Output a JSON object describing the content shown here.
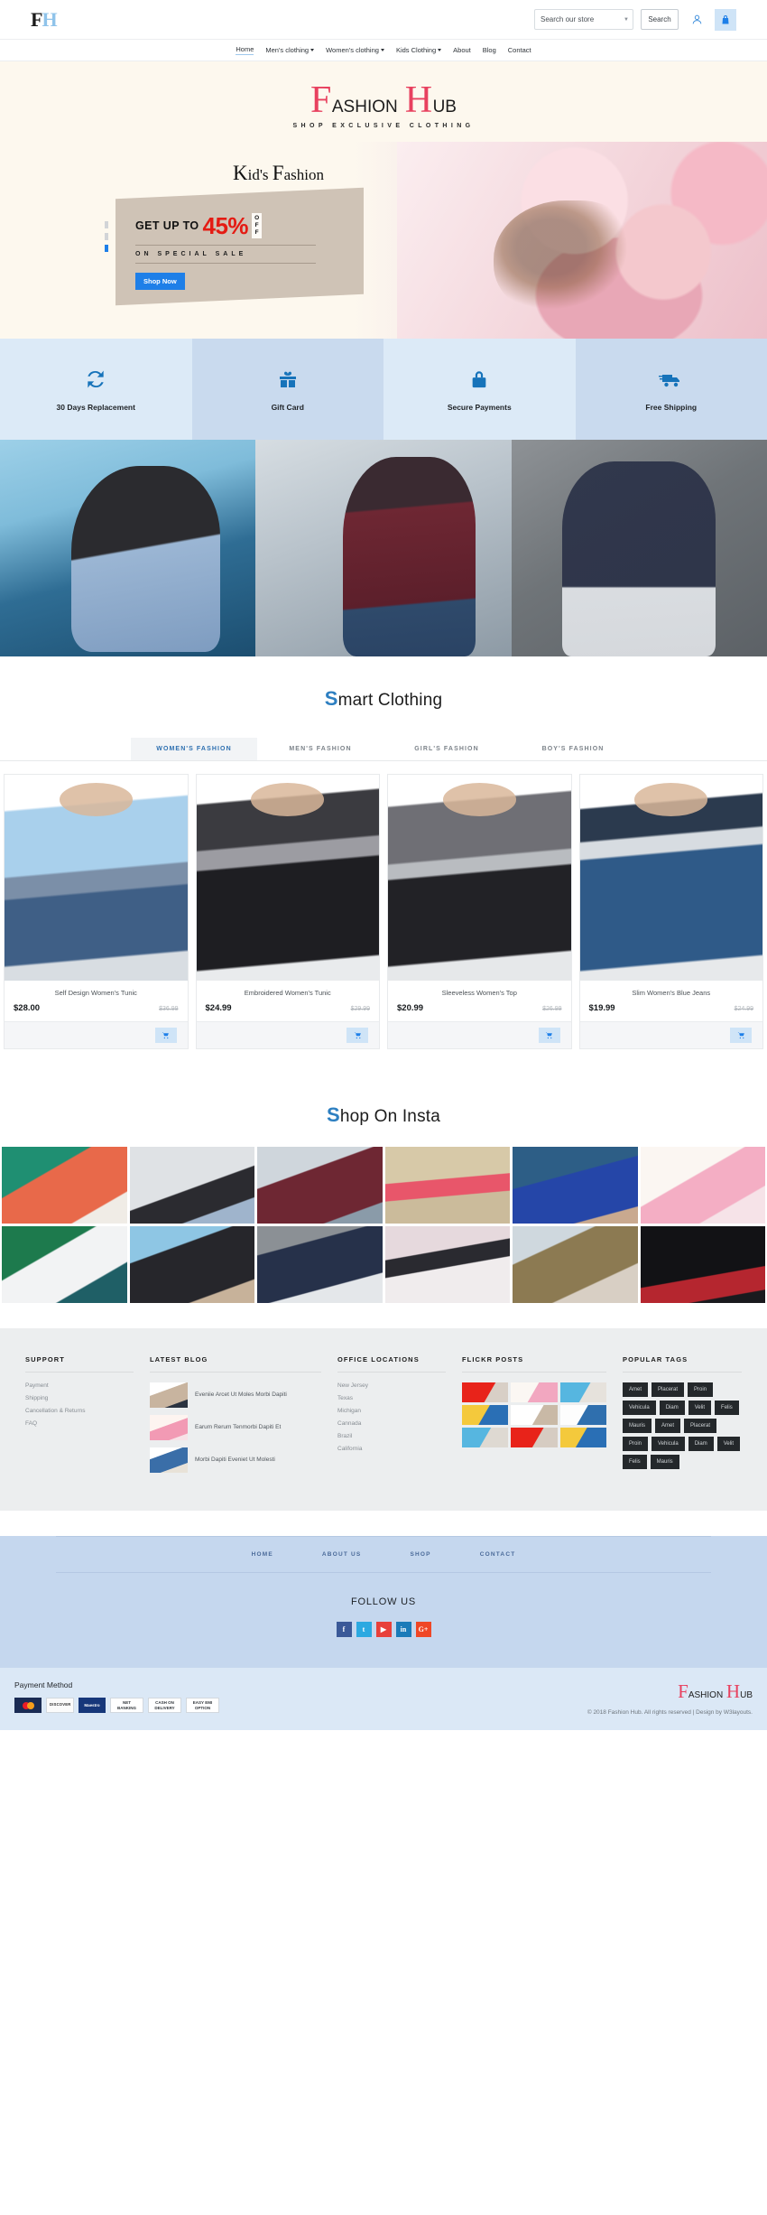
{
  "header": {
    "logo_f": "F",
    "logo_h": "H",
    "search": {
      "select_value": "Search our store",
      "button_label": "Search",
      "caret": "▼"
    },
    "account_icon": "user-icon",
    "cart_icon": "shopping-bag-icon"
  },
  "nav": {
    "items": [
      {
        "label": "Home",
        "dropdown": false,
        "active": true
      },
      {
        "label": "Men's clothing",
        "dropdown": true,
        "active": false
      },
      {
        "label": "Women's clothing",
        "dropdown": true,
        "active": false
      },
      {
        "label": "Kids Clothing",
        "dropdown": true,
        "active": false
      },
      {
        "label": "About",
        "dropdown": false,
        "active": false
      },
      {
        "label": "Blog",
        "dropdown": false,
        "active": false
      },
      {
        "label": "Contact",
        "dropdown": false,
        "active": false
      }
    ]
  },
  "brand": {
    "word1_cap": "F",
    "word1_rest": "ASHION",
    "word2_cap": "H",
    "word2_rest": "UB",
    "tagline": "SHOP EXCLUSIVE CLOTHING"
  },
  "hero": {
    "title_cap": "K",
    "title_rest1": "id's ",
    "title_cap2": "F",
    "title_rest2": "ashion",
    "get_up_to": "GET UP TO",
    "percent": "45%",
    "off_o": "O",
    "off_f1": "F",
    "off_f2": "F",
    "subtitle": "ON  SPECIAL  SALE",
    "cta": "Shop Now",
    "slides": 3,
    "active_slide": 3
  },
  "services": [
    {
      "label": "30 Days Replacement",
      "icon": "refresh-icon"
    },
    {
      "label": "Gift Card",
      "icon": "gift-icon"
    },
    {
      "label": "Secure Payments",
      "icon": "lock-icon"
    },
    {
      "label": "Free Shipping",
      "icon": "truck-icon"
    }
  ],
  "categories": [
    {
      "name": "women-category"
    },
    {
      "name": "men-category"
    },
    {
      "name": "kids-category"
    }
  ],
  "smart_clothing": {
    "title_accent": "S",
    "title_rest": "mart Clothing",
    "tabs": [
      {
        "label": "WOMEN'S FASHION",
        "active": true
      },
      {
        "label": "MEN'S FASHION",
        "active": false
      },
      {
        "label": "GIRL'S FASHION",
        "active": false
      },
      {
        "label": "BOY'S FASHION",
        "active": false
      }
    ],
    "products": [
      {
        "name": "Self Design Women's Tunic",
        "price": "$28.00",
        "old_price": "$36.99"
      },
      {
        "name": "Embroidered Women's Tunic",
        "price": "$24.99",
        "old_price": "$29.99"
      },
      {
        "name": "Sleeveless Women's Top",
        "price": "$20.99",
        "old_price": "$26.99"
      },
      {
        "name": "Slim Women's Blue Jeans",
        "price": "$19.99",
        "old_price": "$24.99"
      }
    ],
    "cart_icon": "shopping-cart-icon"
  },
  "insta": {
    "title_accent": "S",
    "title_rest": "hop On Insta",
    "cells": 12
  },
  "footer": {
    "support": {
      "title": "SUPPORT",
      "links": [
        "Payment",
        "Shipping",
        "Cancellation & Returns",
        "FAQ"
      ]
    },
    "blog": {
      "title": "LATEST BLOG",
      "posts": [
        "Eveniie Arcet Ut Moles Morbi Dapiti",
        "Earum Rerum Tenmorbi Dapiti Et",
        "Morbi Dapiti Eveniet Ut Molesti"
      ]
    },
    "offices": {
      "title": "OFFICE LOCATIONS",
      "locations": [
        "New Jersey",
        "Texas",
        "Michigan",
        "Cannada",
        "Brazil",
        "California"
      ]
    },
    "flickr": {
      "title": "FLICKR POSTS",
      "cells": 9
    },
    "tags": {
      "title": "POPULAR TAGS",
      "items": [
        "Amet",
        "Placerat",
        "Proin",
        "Vehicula",
        "Diam",
        "Velit",
        "Felis",
        "Mauris",
        "Amet",
        "Placerat",
        "Proin",
        "Vehicula",
        "Diam",
        "Velit",
        "Felis",
        "Mauris"
      ]
    },
    "bottom_nav": [
      "HOME",
      "ABOUT US",
      "SHOP",
      "CONTACT"
    ],
    "follow_title": "FOLLOW US",
    "socials": [
      {
        "name": "facebook",
        "glyph": "f",
        "color": "#3b5998"
      },
      {
        "name": "twitter",
        "glyph": "t",
        "color": "#2ca9e1"
      },
      {
        "name": "youtube",
        "glyph": "▶",
        "color": "#e8403a"
      },
      {
        "name": "linkedin",
        "glyph": "in",
        "color": "#1b7bb9"
      },
      {
        "name": "googleplus",
        "glyph": "G+",
        "color": "#ef4726"
      }
    ],
    "payment": {
      "title": "Payment Method",
      "methods": [
        {
          "name": "mastercard",
          "label": ""
        },
        {
          "name": "discover",
          "label": "DISCOVER"
        },
        {
          "name": "maestro",
          "label": "Maestro"
        },
        {
          "name": "net-banking",
          "label": "NET BANKING"
        },
        {
          "name": "cash-on-delivery",
          "label": "CASH ON DELIVERY"
        },
        {
          "name": "easy-emi",
          "label": "EASY EMI OPTION"
        }
      ]
    },
    "logo": {
      "word1_cap": "F",
      "word1_rest": "ASHION",
      "word2_cap": "H",
      "word2_rest": "UB"
    },
    "copyright": "© 2018 Fashion Hub. All rights reserved | Design by W3layouts."
  }
}
